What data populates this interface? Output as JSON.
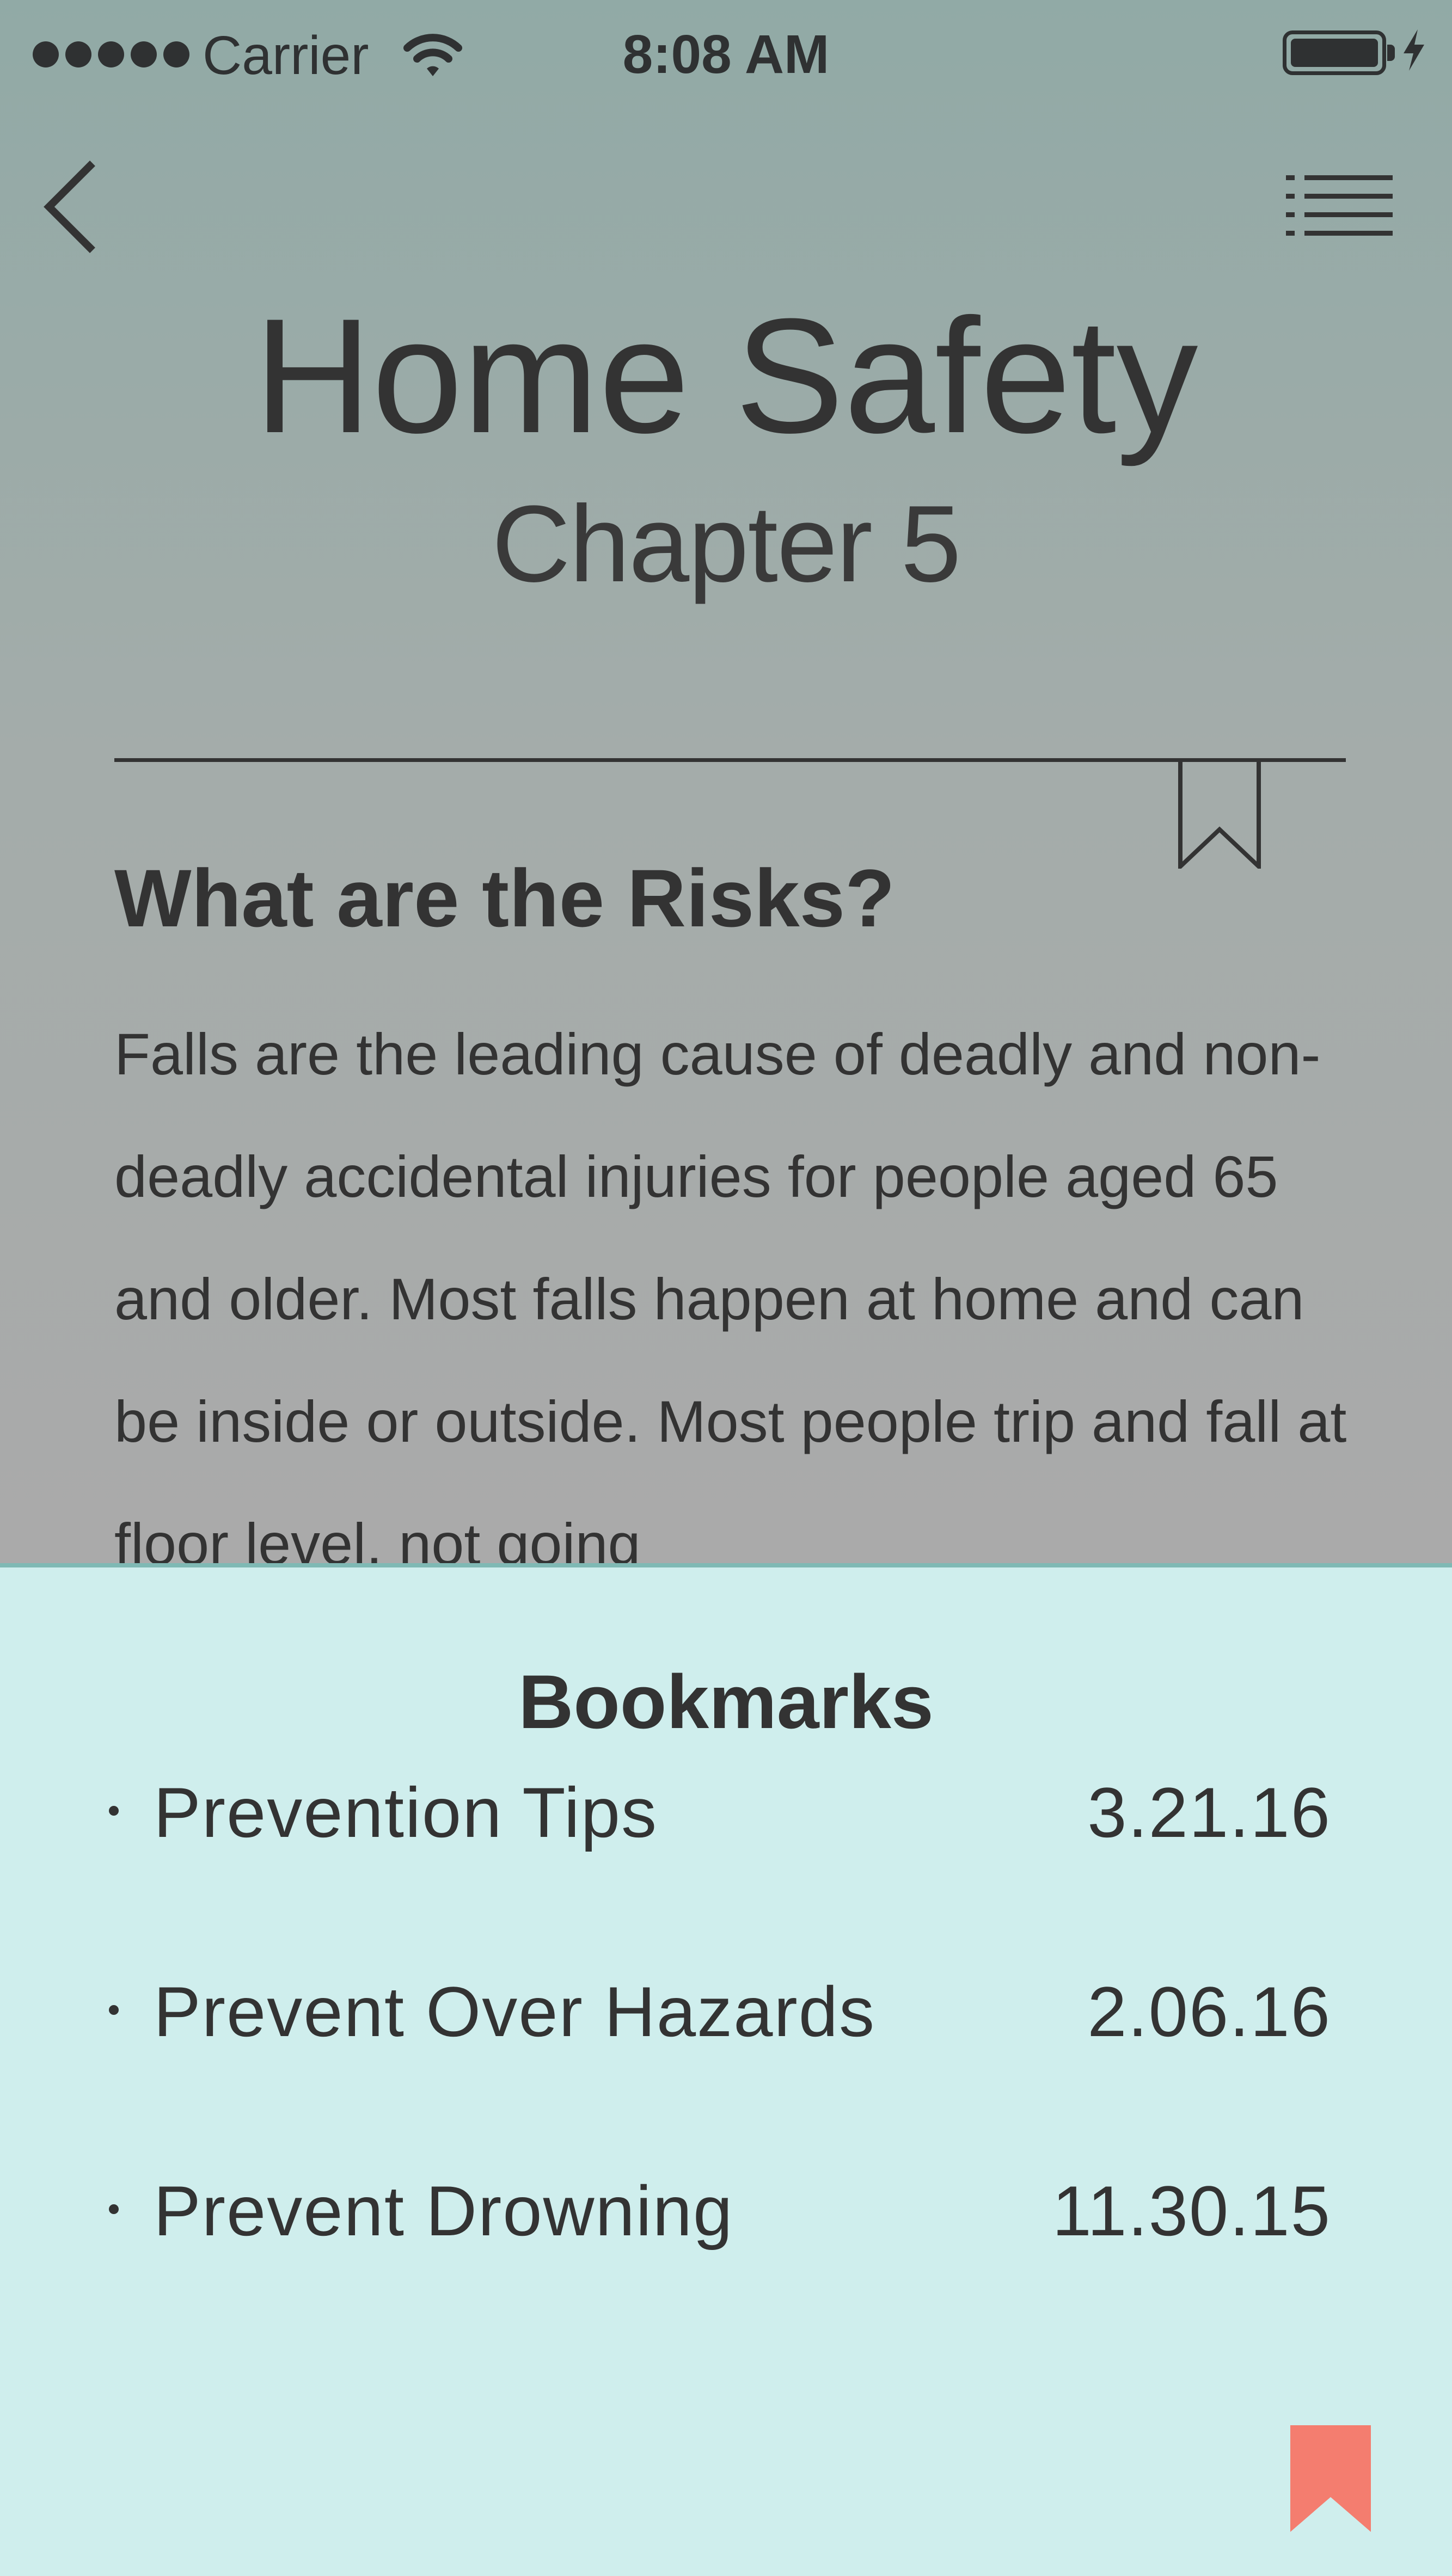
{
  "status_bar": {
    "carrier": "Carrier",
    "time": "8:08 AM",
    "icons": [
      "signal-dots-icon",
      "wifi-icon",
      "battery-icon",
      "charging-bolt-icon"
    ]
  },
  "nav": {
    "back_icon": "chevron-left-icon",
    "menu_icon": "list-menu-icon"
  },
  "header": {
    "title": "Home Safety",
    "chapter": "Chapter 5"
  },
  "content": {
    "bookmark_icon": "bookmark-outline-icon",
    "heading": "What are the Risks?",
    "body": "Falls are the leading cause of deadly and non-deadly accidental injuries for people aged 65 and older. Most falls happen at home and can be inside or outside. Most people trip and fall at floor level, not going"
  },
  "bookmarks_panel": {
    "title": "Bookmarks",
    "items": [
      {
        "label": "Prevention Tips",
        "date": "3.21.16"
      },
      {
        "label": "Prevent Over Hazards",
        "date": "2.06.16"
      },
      {
        "label": "Prevent Drowning",
        "date": "11.30.15"
      }
    ],
    "ribbon_icon": "bookmark-filled-icon"
  },
  "colors": {
    "header_top": "#91aaa6",
    "content_bg": "#aaaaaa",
    "panel_bg": "#cfeeed",
    "panel_border": "#7fb9b4",
    "text": "#333333",
    "ribbon": "#f47d6f"
  }
}
